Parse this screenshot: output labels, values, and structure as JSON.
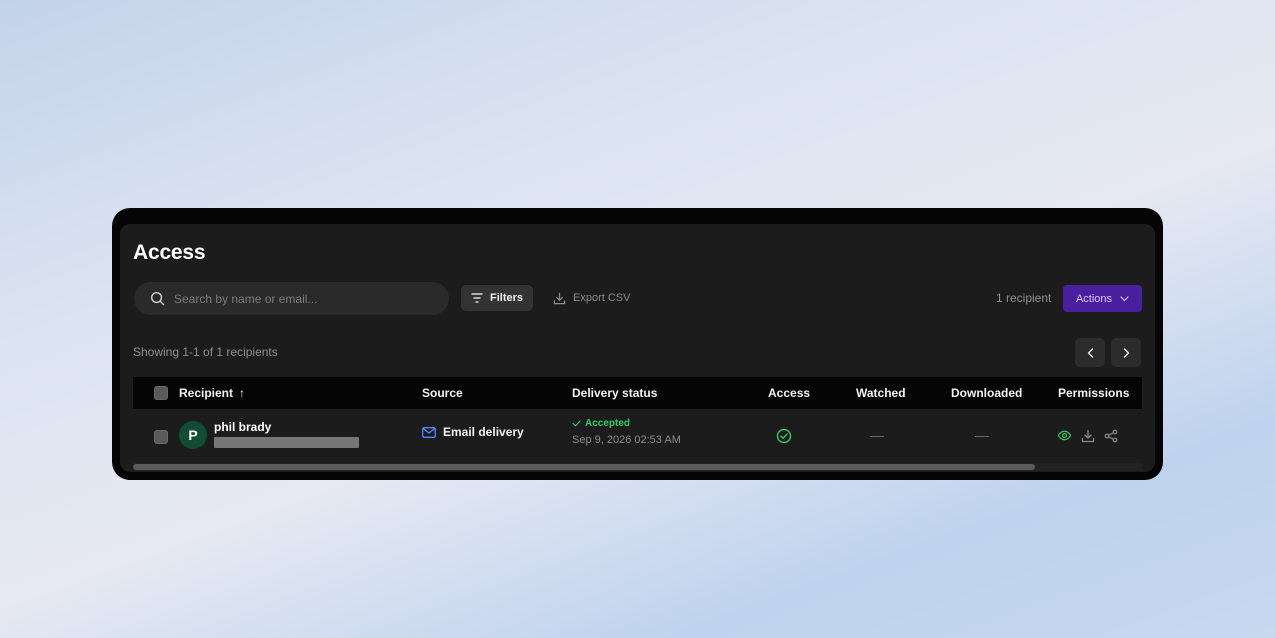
{
  "page": {
    "title": "Access"
  },
  "toolbar": {
    "search_placeholder": "Search by name or email...",
    "filters_label": "Filters",
    "export_label": "Export CSV",
    "recipient_count": "1 recipient",
    "actions_label": "Actions"
  },
  "pagination": {
    "showing_text": "Showing 1-1 of 1 recipients"
  },
  "table": {
    "columns": [
      "Recipient",
      "Source",
      "Delivery status",
      "Access",
      "Watched",
      "Downloaded",
      "Permissions"
    ],
    "sort_indicator": "↑",
    "rows": [
      {
        "avatar_initial": "P",
        "name": "phil brady",
        "source": "Email delivery",
        "delivery_status": "Accepted",
        "delivery_date": "Sep 9, 2026 02:53 AM",
        "access": "granted-check-icon",
        "watched": "—",
        "downloaded": "—",
        "permissions": [
          "view-icon",
          "download-icon",
          "share-icon"
        ]
      }
    ]
  },
  "colors": {
    "accent": "#4a1f9e",
    "success": "#2ecc63",
    "avatar_bg": "#114c37",
    "source_icon": "#4f8cff"
  }
}
